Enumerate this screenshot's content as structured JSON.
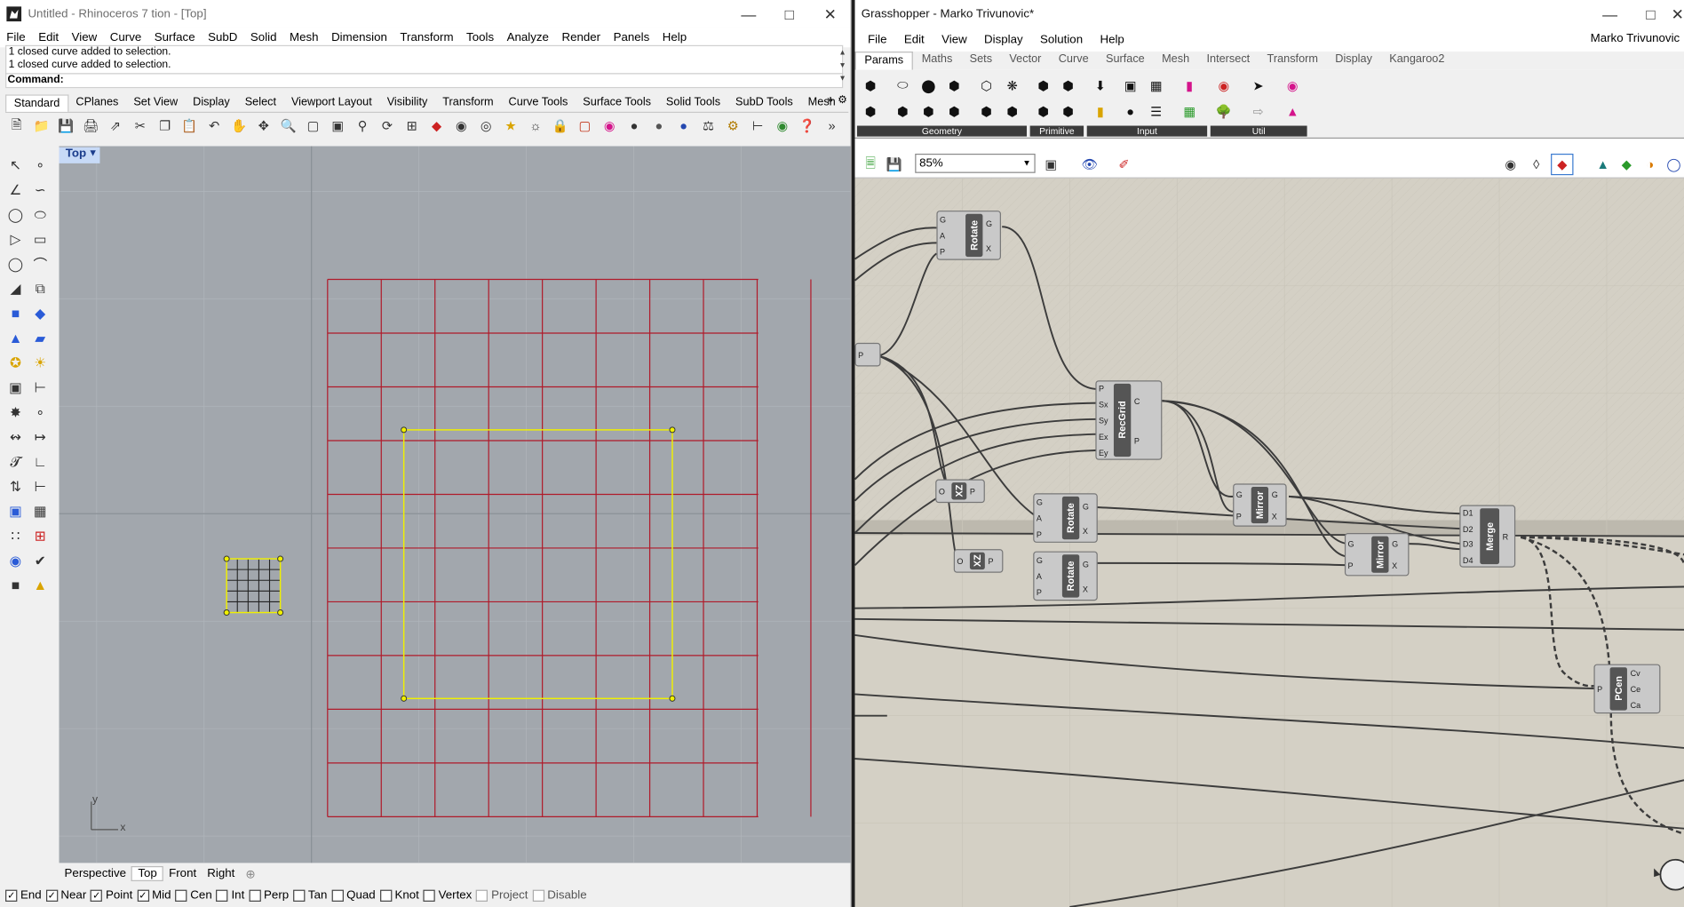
{
  "rhino": {
    "title": "Untitled - Rhinoceros 7 tion - [Top]",
    "menu": [
      "File",
      "Edit",
      "View",
      "Curve",
      "Surface",
      "SubD",
      "Solid",
      "Mesh",
      "Dimension",
      "Transform",
      "Tools",
      "Analyze",
      "Render",
      "Panels",
      "Help"
    ],
    "history": [
      "1 closed curve added to selection.",
      "1 closed curve added to selection."
    ],
    "command_label": "Command:",
    "toolbar_tabs": [
      "Standard",
      "CPlanes",
      "Set View",
      "Display",
      "Select",
      "Viewport Layout",
      "Visibility",
      "Transform",
      "Curve Tools",
      "Surface Tools",
      "Solid Tools",
      "SubD Tools",
      "Mesh"
    ],
    "active_toolbar_tab": "Standard",
    "viewport": {
      "name": "Top",
      "axis_x": "x",
      "axis_y": "y"
    },
    "view_tabs": [
      "Perspective",
      "Top",
      "Front",
      "Right"
    ],
    "active_view_tab": "Top",
    "osnaps": [
      {
        "label": "End",
        "checked": true
      },
      {
        "label": "Near",
        "checked": true
      },
      {
        "label": "Point",
        "checked": true
      },
      {
        "label": "Mid",
        "checked": true
      },
      {
        "label": "Cen",
        "checked": false
      },
      {
        "label": "Int",
        "checked": false
      },
      {
        "label": "Perp",
        "checked": false
      },
      {
        "label": "Tan",
        "checked": false
      },
      {
        "label": "Quad",
        "checked": false
      },
      {
        "label": "Knot",
        "checked": false
      },
      {
        "label": "Vertex",
        "checked": false
      },
      {
        "label": "Project",
        "checked": false,
        "disabled": true
      },
      {
        "label": "Disable",
        "checked": false,
        "disabled": true
      }
    ],
    "colors": {
      "viewport_bg": "#a2a7ad",
      "grid_curve": "#b01a2a",
      "selected_curve": "#f0f000"
    }
  },
  "grasshopper": {
    "title": "Grasshopper - Marko Trivunovic*",
    "menu": [
      "File",
      "Edit",
      "View",
      "Display",
      "Solution",
      "Help"
    ],
    "user": "Marko Trivunovic",
    "tabs": [
      "Params",
      "Maths",
      "Sets",
      "Vector",
      "Curve",
      "Surface",
      "Mesh",
      "Intersect",
      "Transform",
      "Display",
      "Kangaroo2"
    ],
    "active_tab": "Params",
    "ribbon_groups": [
      "Geometry",
      "Primitive",
      "Input",
      "Util"
    ],
    "zoom": "85%",
    "components": {
      "rotate1": {
        "name": "Rotate",
        "inputs": [
          "G",
          "A",
          "P"
        ],
        "outputs": [
          "G",
          "X"
        ]
      },
      "recgrid": {
        "name": "RecGrid",
        "inputs": [
          "P",
          "Sx",
          "Sy",
          "Ex",
          "Ey"
        ],
        "outputs": [
          "C",
          "P"
        ]
      },
      "xz1": {
        "name": "XZ",
        "inputs": [
          "O"
        ],
        "outputs": [
          "P"
        ]
      },
      "xz2": {
        "name": "XZ",
        "inputs": [
          "O"
        ],
        "outputs": [
          "P"
        ]
      },
      "rotate2": {
        "name": "Rotate",
        "inputs": [
          "G",
          "A",
          "P"
        ],
        "outputs": [
          "G",
          "X"
        ]
      },
      "rotate3": {
        "name": "Rotate",
        "inputs": [
          "G",
          "A",
          "P"
        ],
        "outputs": [
          "G",
          "X"
        ]
      },
      "mirror1": {
        "name": "Mirror",
        "inputs": [
          "G",
          "P"
        ],
        "outputs": [
          "G",
          "X"
        ]
      },
      "mirror2": {
        "name": "Mirror",
        "inputs": [
          "G",
          "P"
        ],
        "outputs": [
          "G",
          "X"
        ]
      },
      "merge": {
        "name": "Merge",
        "inputs": [
          "D1",
          "D2",
          "D3",
          "D4"
        ],
        "outputs": [
          "R"
        ]
      },
      "pcen": {
        "name": "PCen",
        "inputs": [
          "P"
        ],
        "outputs": [
          "Cv",
          "Ce",
          "Ca"
        ]
      },
      "point": {
        "name": "",
        "inputs": [],
        "outputs": [
          "P"
        ]
      }
    },
    "colors": {
      "canvas_bg": "#d4d0c5",
      "component": "#c9c9c9",
      "component_core": "#555555",
      "wire": "#3c3c3c"
    }
  }
}
